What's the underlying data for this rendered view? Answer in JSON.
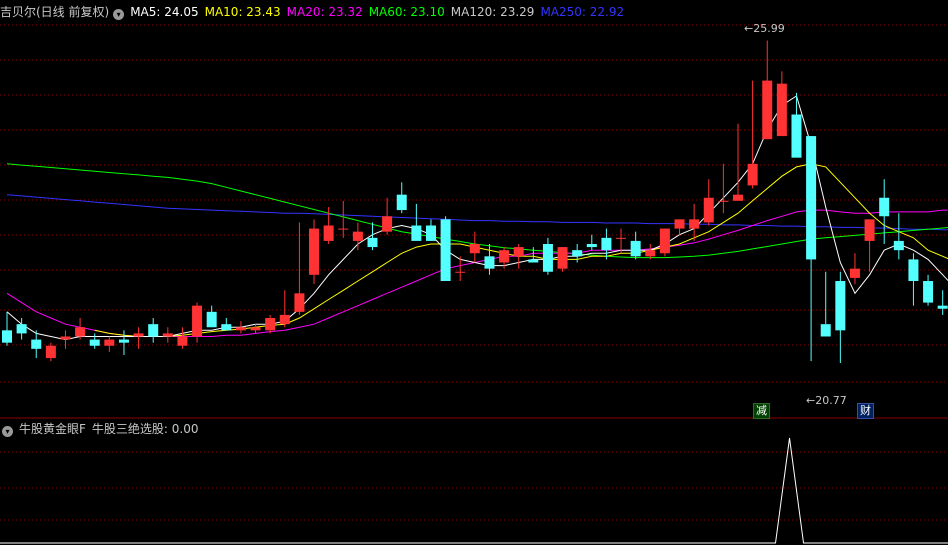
{
  "main_header": {
    "stock_name": "吉贝尔(日线 前复权)",
    "ma_items": [
      {
        "label": "MA5: 24.05",
        "color": "#ffffff"
      },
      {
        "label": "MA10: 23.43",
        "color": "#ffff00"
      },
      {
        "label": "MA20: 23.32",
        "color": "#ff00ff"
      },
      {
        "label": "MA60: 23.10",
        "color": "#00ff00"
      },
      {
        "label": "MA120: 23.29",
        "color": "#c8c8c8"
      },
      {
        "label": "MA250: 22.92",
        "color": "#3333ff"
      }
    ]
  },
  "sub_header": {
    "indicator_name": "牛股黄金眼F",
    "indicator_value": "牛股三绝选股: 0.00"
  },
  "annotations": {
    "high_label": "25.99",
    "low_label": "20.77",
    "tag_jian": "减",
    "tag_cai": "财"
  },
  "colors": {
    "up": "#ff3333",
    "down": "#54ffff",
    "grid": "#8b0000",
    "ma5": "#ffffff",
    "ma10": "#ffff00",
    "ma20": "#ff00ff",
    "ma60": "#00ff00",
    "ma250": "#3333ff"
  },
  "chart_data": {
    "type": "candlestick",
    "ylim": [
      20.3,
      26.3
    ],
    "ohlc": [
      [
        21.3,
        21.6,
        21.05,
        21.1
      ],
      [
        21.4,
        21.5,
        21.15,
        21.25
      ],
      [
        21.15,
        21.3,
        20.85,
        21.0
      ],
      [
        20.85,
        21.1,
        20.8,
        21.05
      ],
      [
        21.15,
        21.3,
        21.0,
        21.2
      ],
      [
        21.2,
        21.5,
        21.15,
        21.35
      ],
      [
        21.15,
        21.25,
        21.0,
        21.05
      ],
      [
        21.05,
        21.2,
        20.95,
        21.15
      ],
      [
        21.15,
        21.3,
        20.9,
        21.1
      ],
      [
        21.2,
        21.35,
        21.0,
        21.25
      ],
      [
        21.4,
        21.5,
        21.1,
        21.2
      ],
      [
        21.2,
        21.35,
        21.1,
        21.25
      ],
      [
        21.05,
        21.35,
        21.0,
        21.2
      ],
      [
        21.2,
        21.75,
        21.1,
        21.7
      ],
      [
        21.6,
        21.7,
        21.35,
        21.35
      ],
      [
        21.4,
        21.5,
        21.3,
        21.3
      ],
      [
        21.3,
        21.45,
        21.25,
        21.35
      ],
      [
        21.3,
        21.4,
        21.25,
        21.35
      ],
      [
        21.3,
        21.55,
        21.25,
        21.5
      ],
      [
        21.4,
        21.95,
        21.35,
        21.55
      ],
      [
        21.6,
        23.05,
        21.55,
        21.9
      ],
      [
        22.2,
        23.1,
        22.05,
        22.95
      ],
      [
        22.75,
        23.3,
        22.7,
        23.0
      ],
      [
        22.95,
        23.4,
        22.8,
        22.95
      ],
      [
        22.75,
        23.05,
        22.6,
        22.9
      ],
      [
        22.8,
        23.05,
        22.6,
        22.65
      ],
      [
        22.9,
        23.45,
        22.85,
        23.15
      ],
      [
        23.5,
        23.7,
        23.2,
        23.25
      ],
      [
        23.0,
        23.35,
        22.8,
        22.75
      ],
      [
        23.0,
        23.1,
        22.75,
        22.75
      ],
      [
        23.1,
        23.15,
        22.2,
        22.1
      ],
      [
        22.25,
        22.5,
        22.1,
        22.25
      ],
      [
        22.55,
        22.9,
        22.4,
        22.7
      ],
      [
        22.5,
        22.7,
        22.2,
        22.3
      ],
      [
        22.4,
        22.65,
        22.3,
        22.6
      ],
      [
        22.5,
        22.7,
        22.3,
        22.65
      ],
      [
        22.45,
        22.65,
        22.4,
        22.4
      ],
      [
        22.7,
        22.8,
        22.2,
        22.25
      ],
      [
        22.3,
        22.65,
        22.25,
        22.65
      ],
      [
        22.6,
        22.7,
        22.4,
        22.5
      ],
      [
        22.7,
        22.85,
        22.6,
        22.65
      ],
      [
        22.8,
        22.95,
        22.45,
        22.6
      ],
      [
        22.8,
        22.95,
        22.55,
        22.8
      ],
      [
        22.75,
        22.9,
        22.45,
        22.5
      ],
      [
        22.5,
        22.7,
        22.45,
        22.6
      ],
      [
        22.55,
        22.95,
        22.5,
        22.95
      ],
      [
        22.95,
        23.05,
        22.85,
        23.1
      ],
      [
        22.95,
        23.35,
        22.75,
        23.1
      ],
      [
        23.05,
        23.75,
        23.0,
        23.45
      ],
      [
        23.4,
        24.0,
        23.2,
        23.4
      ],
      [
        23.4,
        24.65,
        23.45,
        23.5
      ],
      [
        23.65,
        25.35,
        23.6,
        24.0
      ],
      [
        24.4,
        26.0,
        24.4,
        25.35
      ],
      [
        24.45,
        25.5,
        24.5,
        25.3
      ],
      [
        24.8,
        25.15,
        24.55,
        24.1
      ],
      [
        24.45,
        24.45,
        20.8,
        22.45
      ],
      [
        21.4,
        22.25,
        21.4,
        21.2
      ],
      [
        22.1,
        22.25,
        20.77,
        21.3
      ],
      [
        22.15,
        22.55,
        22.05,
        22.3
      ],
      [
        22.75,
        22.9,
        22.25,
        23.1
      ],
      [
        23.45,
        23.75,
        22.7,
        23.15
      ],
      [
        22.75,
        23.2,
        22.45,
        22.6
      ],
      [
        22.45,
        22.55,
        21.7,
        22.1
      ],
      [
        22.1,
        22.2,
        21.7,
        21.75
      ],
      [
        21.7,
        21.95,
        21.55,
        21.65
      ],
      [
        21.95,
        22.05,
        21.55,
        21.85
      ],
      [
        22.1,
        23.55,
        21.6,
        23.1
      ]
    ],
    "ma5": [
      21.6,
      21.4,
      21.25,
      21.2,
      21.15,
      21.2,
      21.2,
      21.2,
      21.2,
      21.2,
      21.2,
      21.2,
      21.25,
      21.3,
      21.3,
      21.35,
      21.35,
      21.4,
      21.4,
      21.45,
      21.65,
      21.9,
      22.2,
      22.45,
      22.7,
      22.85,
      22.95,
      23.0,
      22.95,
      22.85,
      22.6,
      22.45,
      22.4,
      22.35,
      22.35,
      22.4,
      22.45,
      22.45,
      22.5,
      22.5,
      22.55,
      22.55,
      22.6,
      22.6,
      22.6,
      22.7,
      22.85,
      22.95,
      23.2,
      23.45,
      23.7,
      24.0,
      24.55,
      24.95,
      25.1,
      24.3,
      23.3,
      22.4,
      21.9,
      22.2,
      22.6,
      22.7,
      22.6,
      22.45,
      22.2,
      21.95,
      22.2
    ],
    "ma10": [
      null,
      null,
      null,
      null,
      null,
      null,
      21.3,
      21.25,
      21.22,
      21.2,
      21.2,
      21.2,
      21.22,
      21.25,
      21.28,
      21.3,
      21.32,
      21.35,
      21.38,
      21.4,
      21.5,
      21.65,
      21.8,
      21.95,
      22.1,
      22.25,
      22.4,
      22.55,
      22.65,
      22.7,
      22.7,
      22.7,
      22.65,
      22.6,
      22.55,
      22.5,
      22.5,
      22.45,
      22.45,
      22.45,
      22.5,
      22.5,
      22.55,
      22.55,
      22.6,
      22.65,
      22.7,
      22.8,
      22.9,
      23.05,
      23.2,
      23.4,
      23.6,
      23.8,
      23.95,
      24.0,
      23.95,
      23.7,
      23.45,
      23.2,
      23.0,
      22.9,
      22.8,
      22.6,
      22.5,
      22.4,
      22.5
    ],
    "ma20": [
      21.9,
      21.75,
      21.6,
      21.5,
      21.4,
      21.35,
      21.3,
      21.25,
      21.22,
      21.2,
      21.2,
      21.2,
      21.2,
      21.2,
      21.2,
      21.22,
      21.22,
      21.25,
      21.28,
      21.3,
      21.35,
      21.4,
      21.5,
      21.6,
      21.7,
      21.8,
      21.9,
      22.0,
      22.1,
      22.2,
      22.3,
      22.35,
      22.4,
      22.45,
      22.5,
      22.5,
      22.55,
      22.55,
      22.55,
      22.55,
      22.6,
      22.6,
      22.6,
      22.6,
      22.62,
      22.65,
      22.68,
      22.72,
      22.78,
      22.85,
      22.92,
      23.0,
      23.08,
      23.15,
      23.22,
      23.25,
      23.25,
      23.22,
      23.2,
      23.2,
      23.22,
      23.22,
      23.22,
      23.22,
      23.25,
      23.25,
      23.3
    ],
    "ma60": [
      24.0,
      23.98,
      23.96,
      23.94,
      23.92,
      23.9,
      23.88,
      23.86,
      23.84,
      23.82,
      23.8,
      23.78,
      23.75,
      23.72,
      23.68,
      23.62,
      23.56,
      23.5,
      23.44,
      23.38,
      23.32,
      23.26,
      23.2,
      23.14,
      23.08,
      23.02,
      22.96,
      22.9,
      22.86,
      22.82,
      22.78,
      22.74,
      22.7,
      22.67,
      22.64,
      22.62,
      22.6,
      22.58,
      22.56,
      22.54,
      22.52,
      22.5,
      22.49,
      22.48,
      22.48,
      22.48,
      22.49,
      22.5,
      22.52,
      22.55,
      22.58,
      22.62,
      22.66,
      22.7,
      22.74,
      22.78,
      22.8,
      22.82,
      22.84,
      22.86,
      22.88,
      22.9,
      22.92,
      22.94,
      22.96,
      22.98,
      23.0
    ],
    "ma250": [
      23.5,
      23.48,
      23.46,
      23.44,
      23.42,
      23.4,
      23.38,
      23.36,
      23.34,
      23.32,
      23.3,
      23.28,
      23.27,
      23.26,
      23.25,
      23.24,
      23.23,
      23.22,
      23.21,
      23.2,
      23.2,
      23.19,
      23.18,
      23.17,
      23.16,
      23.15,
      23.14,
      23.13,
      23.12,
      23.11,
      23.1,
      23.09,
      23.08,
      23.08,
      23.07,
      23.07,
      23.06,
      23.06,
      23.05,
      23.05,
      23.05,
      23.04,
      23.04,
      23.04,
      23.03,
      23.03,
      23.03,
      23.02,
      23.02,
      23.01,
      23.01,
      23.0,
      23.0,
      22.99,
      22.99,
      22.98,
      22.98,
      22.97,
      22.97,
      22.96,
      22.96,
      22.95,
      22.94,
      22.94,
      22.93,
      22.93,
      22.92
    ],
    "indicator": [
      0,
      0,
      0,
      0,
      0,
      0,
      0,
      0,
      0,
      0,
      0,
      0,
      0,
      0,
      0,
      0,
      0,
      0,
      0,
      0,
      0,
      0,
      0,
      0,
      0,
      0,
      0,
      0,
      0,
      0,
      0,
      0,
      0,
      0,
      0,
      0,
      0,
      0,
      0,
      0,
      0,
      0,
      0,
      0,
      0,
      0,
      1,
      0,
      0,
      0,
      0,
      0,
      0,
      0,
      0,
      0,
      0,
      0,
      0,
      0,
      0,
      0,
      0,
      0,
      0,
      0,
      0
    ],
    "indicator_peak_index": 46,
    "indicator_ylim": [
      0,
      1
    ]
  }
}
